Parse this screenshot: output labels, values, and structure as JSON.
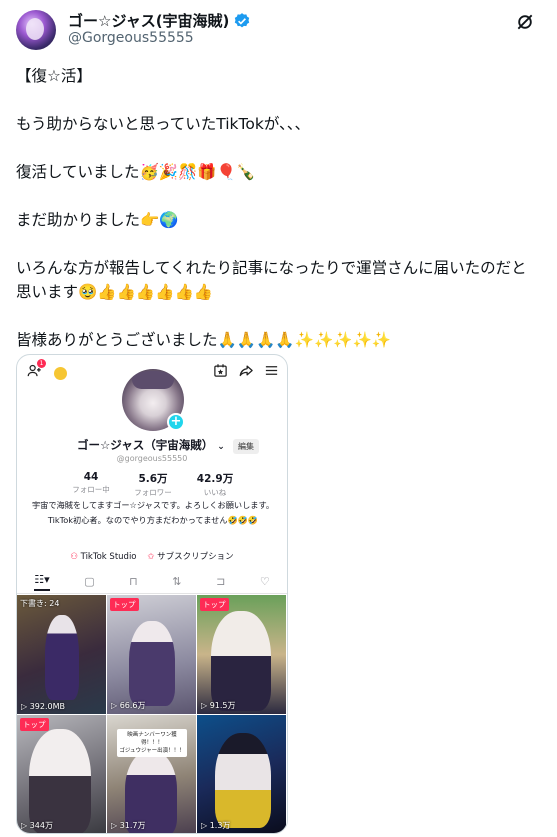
{
  "post": {
    "display_name": "ゴー☆ジャス(宇宙海賊)",
    "handle": "@Gorgeous55555",
    "paragraphs": [
      "【復☆活】",
      "もう助からないと思っていたTikTokが、、、",
      "復活していました🥳🎉🎊🎁🎈🍾",
      "まだ助かりました👉🌍",
      "いろんな方が報告してくれたり記事になったりで運営さんに届いたのだと思います🥹👍👍👍👍👍👍",
      "皆様ありがとうございました🙏🙏🙏🙏✨✨✨✨✨"
    ],
    "icons": {
      "verified": "verified-badge-icon",
      "grok": "grok-icon",
      "more": "more-icon"
    }
  },
  "tiktok": {
    "notif_count": "1",
    "profile_name": "ゴー☆ジャス（宇宙海賊）",
    "edit_label": "編集",
    "handle": "@gorgeous55550",
    "stats": [
      {
        "num": "44",
        "label": "フォロー中"
      },
      {
        "num": "5.6万",
        "label": "フォロワー"
      },
      {
        "num": "42.9万",
        "label": "いいね"
      }
    ],
    "bio": "宇宙で海賊をしてますゴー☆ジャスです。よろしくお願いします。TikTok初心者。なのでやり方まだわかってません🤣🤣🤣",
    "studio_label": "TikTok Studio",
    "subscription_label": "サブスクリプション",
    "videos": [
      {
        "badge": "下書き: 24",
        "views": "392.0MB",
        "badge_type": "draft"
      },
      {
        "badge": "トップ",
        "views": "66.6万",
        "badge_type": "top"
      },
      {
        "badge": "トップ",
        "views": "91.5万",
        "badge_type": "top"
      },
      {
        "badge": "トップ",
        "views": "344万",
        "badge_type": "top"
      },
      {
        "badge": "",
        "views": "31.7万",
        "badge_type": "none",
        "caption_1": "映画ナンバーワン獲得！！！",
        "caption_2": "ゴジュウジャー出演！！！"
      },
      {
        "badge": "",
        "views": "1.3万",
        "badge_type": "none"
      }
    ]
  },
  "colors": {
    "accent_pink": "#fe2c55",
    "verified_blue": "#1d9bf0",
    "tiktok_cyan": "#20d5ec"
  }
}
